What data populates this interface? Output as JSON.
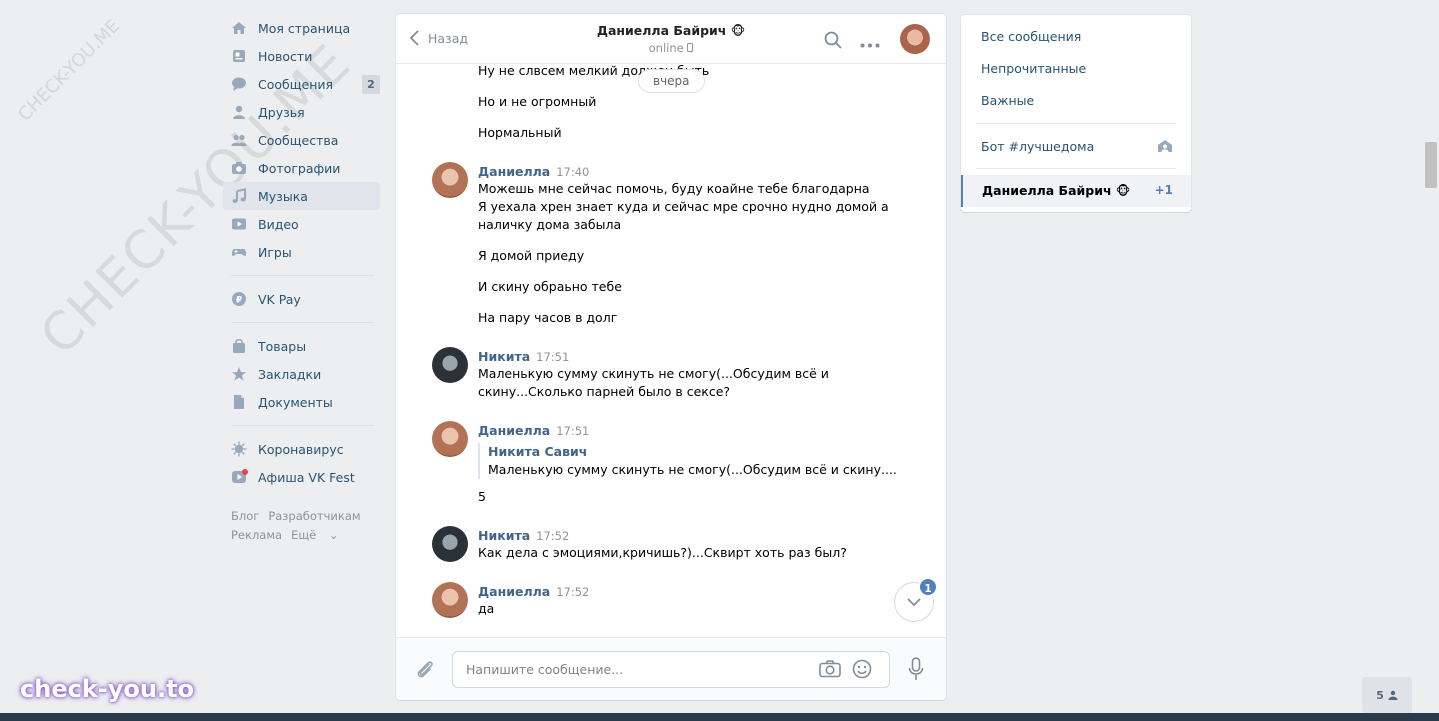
{
  "watermark": {
    "big": "CHECK-YOU.ME",
    "small": "CHECK-YOU.ME",
    "logo": "check-you.to"
  },
  "nav": {
    "items": [
      {
        "label": "Моя страница",
        "icon": "home-icon"
      },
      {
        "label": "Новости",
        "icon": "news-icon"
      },
      {
        "label": "Сообщения",
        "icon": "messages-icon",
        "badge": "2"
      },
      {
        "label": "Друзья",
        "icon": "friends-icon"
      },
      {
        "label": "Сообщества",
        "icon": "groups-icon"
      },
      {
        "label": "Фотографии",
        "icon": "camera-icon"
      },
      {
        "label": "Музыка",
        "icon": "music-icon",
        "active": true
      },
      {
        "label": "Видео",
        "icon": "video-icon"
      },
      {
        "label": "Игры",
        "icon": "games-icon"
      },
      {
        "label": "VK Pay",
        "icon": "vkpay-icon"
      },
      {
        "label": "Товары",
        "icon": "bag-icon"
      },
      {
        "label": "Закладки",
        "icon": "star-icon"
      },
      {
        "label": "Документы",
        "icon": "document-icon"
      },
      {
        "label": "Коронавирус",
        "icon": "virus-icon"
      },
      {
        "label": "Афиша VK Fest",
        "icon": "play-icon"
      }
    ],
    "footer": [
      "Блог",
      "Разработчикам",
      "Реклама",
      "Ещё"
    ]
  },
  "chat": {
    "back_label": "Назад",
    "peer_name": "Даниелла Байрич 🐵",
    "peer_status": "online",
    "date_pill": "вчера",
    "messages": {
      "cut_line": "Ну не слвсем мелкий должен быть",
      "l2": "Но и не огромный",
      "l3": "Нормальный",
      "m1_author": "Даниелла",
      "m1_time": "17:40",
      "m1_l1": "Можешь мне сейчас помочь, буду коайне тебе благодарна",
      "m1_l2": "Я уехала хрен знает куда и сейчас мре срочно нудно домой а",
      "m1_l3": "наличку дома забыла",
      "m1_l4": "Я домой приеду",
      "m1_l5": "И скину обраьно тебе",
      "m1_l6": "На пару часов в долг",
      "m2_author": "Никита",
      "m2_time": "17:51",
      "m2_l1": "Маленькую сумму скинуть не смогу(...Обсудим всё и",
      "m2_l2": "скину...Сколько парней было в сексе?",
      "m3_author": "Даниелла",
      "m3_time": "17:51",
      "m3_quote_author": "Никита Савич",
      "m3_quote_text": "Маленькую сумму скинуть не смогу(...Обсудим всё и скину....",
      "m3_l1": "5",
      "m4_author": "Никита",
      "m4_time": "17:52",
      "m4_l1": "Как дела с эмоциями,кричишь?)...Сквирт хоть раз был?",
      "m5_author": "Даниелла",
      "m5_time": "17:52",
      "m5_l1": "да"
    },
    "unread_badge": "1",
    "input_placeholder": "Напишите сообщение..."
  },
  "right_panel": {
    "all": "Все сообщения",
    "unread": "Непрочитанные",
    "important": "Важные",
    "bot": "Бот #лучшедома",
    "active_chat": "Даниелла Байрич 🐵",
    "active_count": "+1"
  },
  "corner": {
    "friends_count": "5"
  }
}
